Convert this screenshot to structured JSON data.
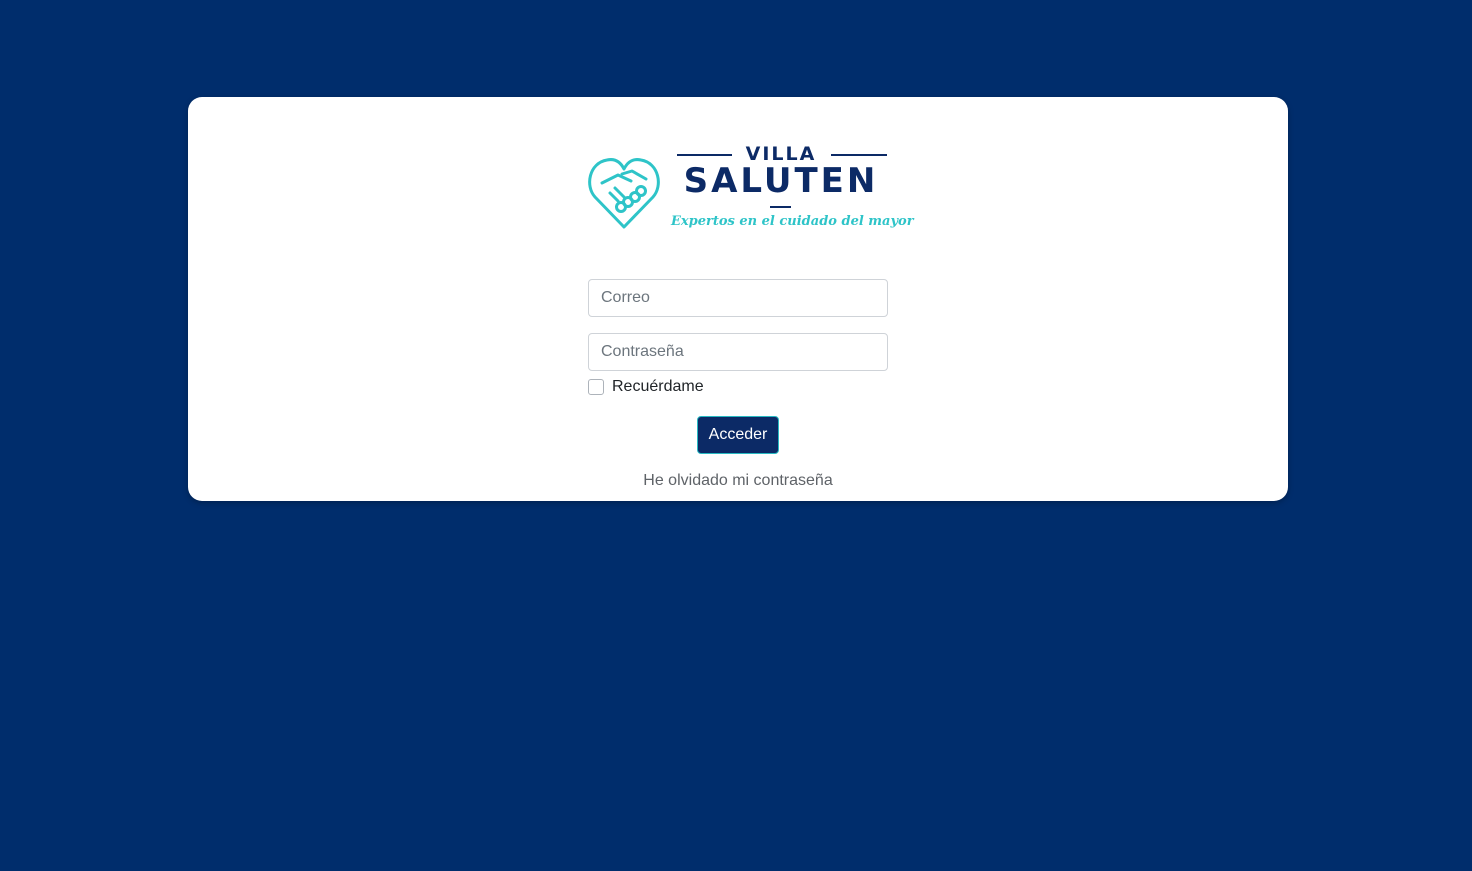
{
  "brand": {
    "name_top": "VILLA",
    "name_main": "SALUTEN",
    "tagline": "Expertos en el cuidado del mayor",
    "logo_icon": "heart-handshake-icon",
    "primary_color": "#0c2a66",
    "accent_color": "#2ec4c8"
  },
  "page": {
    "background_color": "#002d6c"
  },
  "login": {
    "email_placeholder": "Correo",
    "email_value": "",
    "password_placeholder": "Contraseña",
    "password_value": "",
    "remember_label": "Recuérdame",
    "remember_checked": false,
    "submit_label": "Acceder",
    "forgot_label": "He olvidado mi contraseña"
  }
}
